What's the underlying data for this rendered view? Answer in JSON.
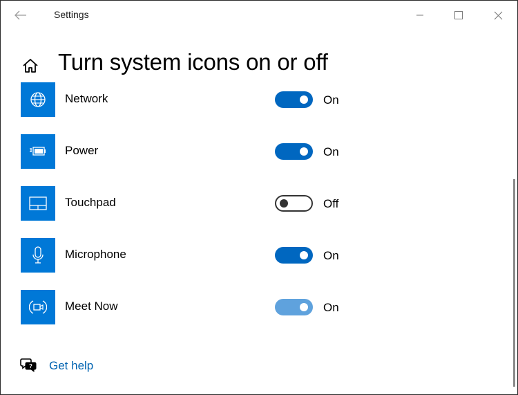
{
  "window": {
    "title": "Settings",
    "controls": [
      "minimize-icon",
      "maximize-icon",
      "close-icon"
    ]
  },
  "header": {
    "back_icon": "back-arrow-icon",
    "home_icon": "home-icon",
    "title": "Turn system icons on or off"
  },
  "settings": {
    "items": [
      {
        "label": "Network",
        "icon": "network-globe-icon",
        "state": "On",
        "enabled": true
      },
      {
        "label": "Power",
        "icon": "power-battery-icon",
        "state": "On",
        "enabled": true
      },
      {
        "label": "Touchpad",
        "icon": "touchpad-icon",
        "state": "Off",
        "enabled": false
      },
      {
        "label": "Microphone",
        "icon": "microphone-icon",
        "state": "On",
        "enabled": true
      },
      {
        "label": "Meet Now",
        "icon": "meet-now-icon",
        "state": "On",
        "enabled": true,
        "dimmed": true
      }
    ]
  },
  "help": {
    "icon": "get-help-icon",
    "label": "Get help"
  },
  "colors": {
    "accent": "#0078d7",
    "toggle_on": "#0067c0",
    "toggle_on_dimmed": "#5fa2dd",
    "link": "#0063b1"
  }
}
